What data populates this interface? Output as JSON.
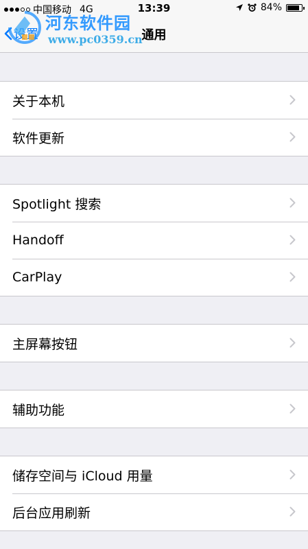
{
  "status_bar": {
    "carrier": "中国移动",
    "network": "4G",
    "time": "13:39",
    "battery_percent": "84%",
    "battery_level": 0.84
  },
  "watermark": {
    "title": "河东软件园",
    "url": "www.pc0359.cn"
  },
  "nav": {
    "back_label": "设置",
    "title": "通用"
  },
  "groups": [
    [
      "关于本机",
      "软件更新"
    ],
    [
      "Spotlight 搜索",
      "Handoff",
      "CarPlay"
    ],
    [
      "主屏幕按钮"
    ],
    [
      "辅助功能"
    ],
    [
      "储存空间与 iCloud 用量",
      "后台应用刷新"
    ]
  ],
  "colors": {
    "accent": "#007aff",
    "background": "#efeff4",
    "separator": "#c8c7cc",
    "chevron": "#c7c7cc"
  }
}
